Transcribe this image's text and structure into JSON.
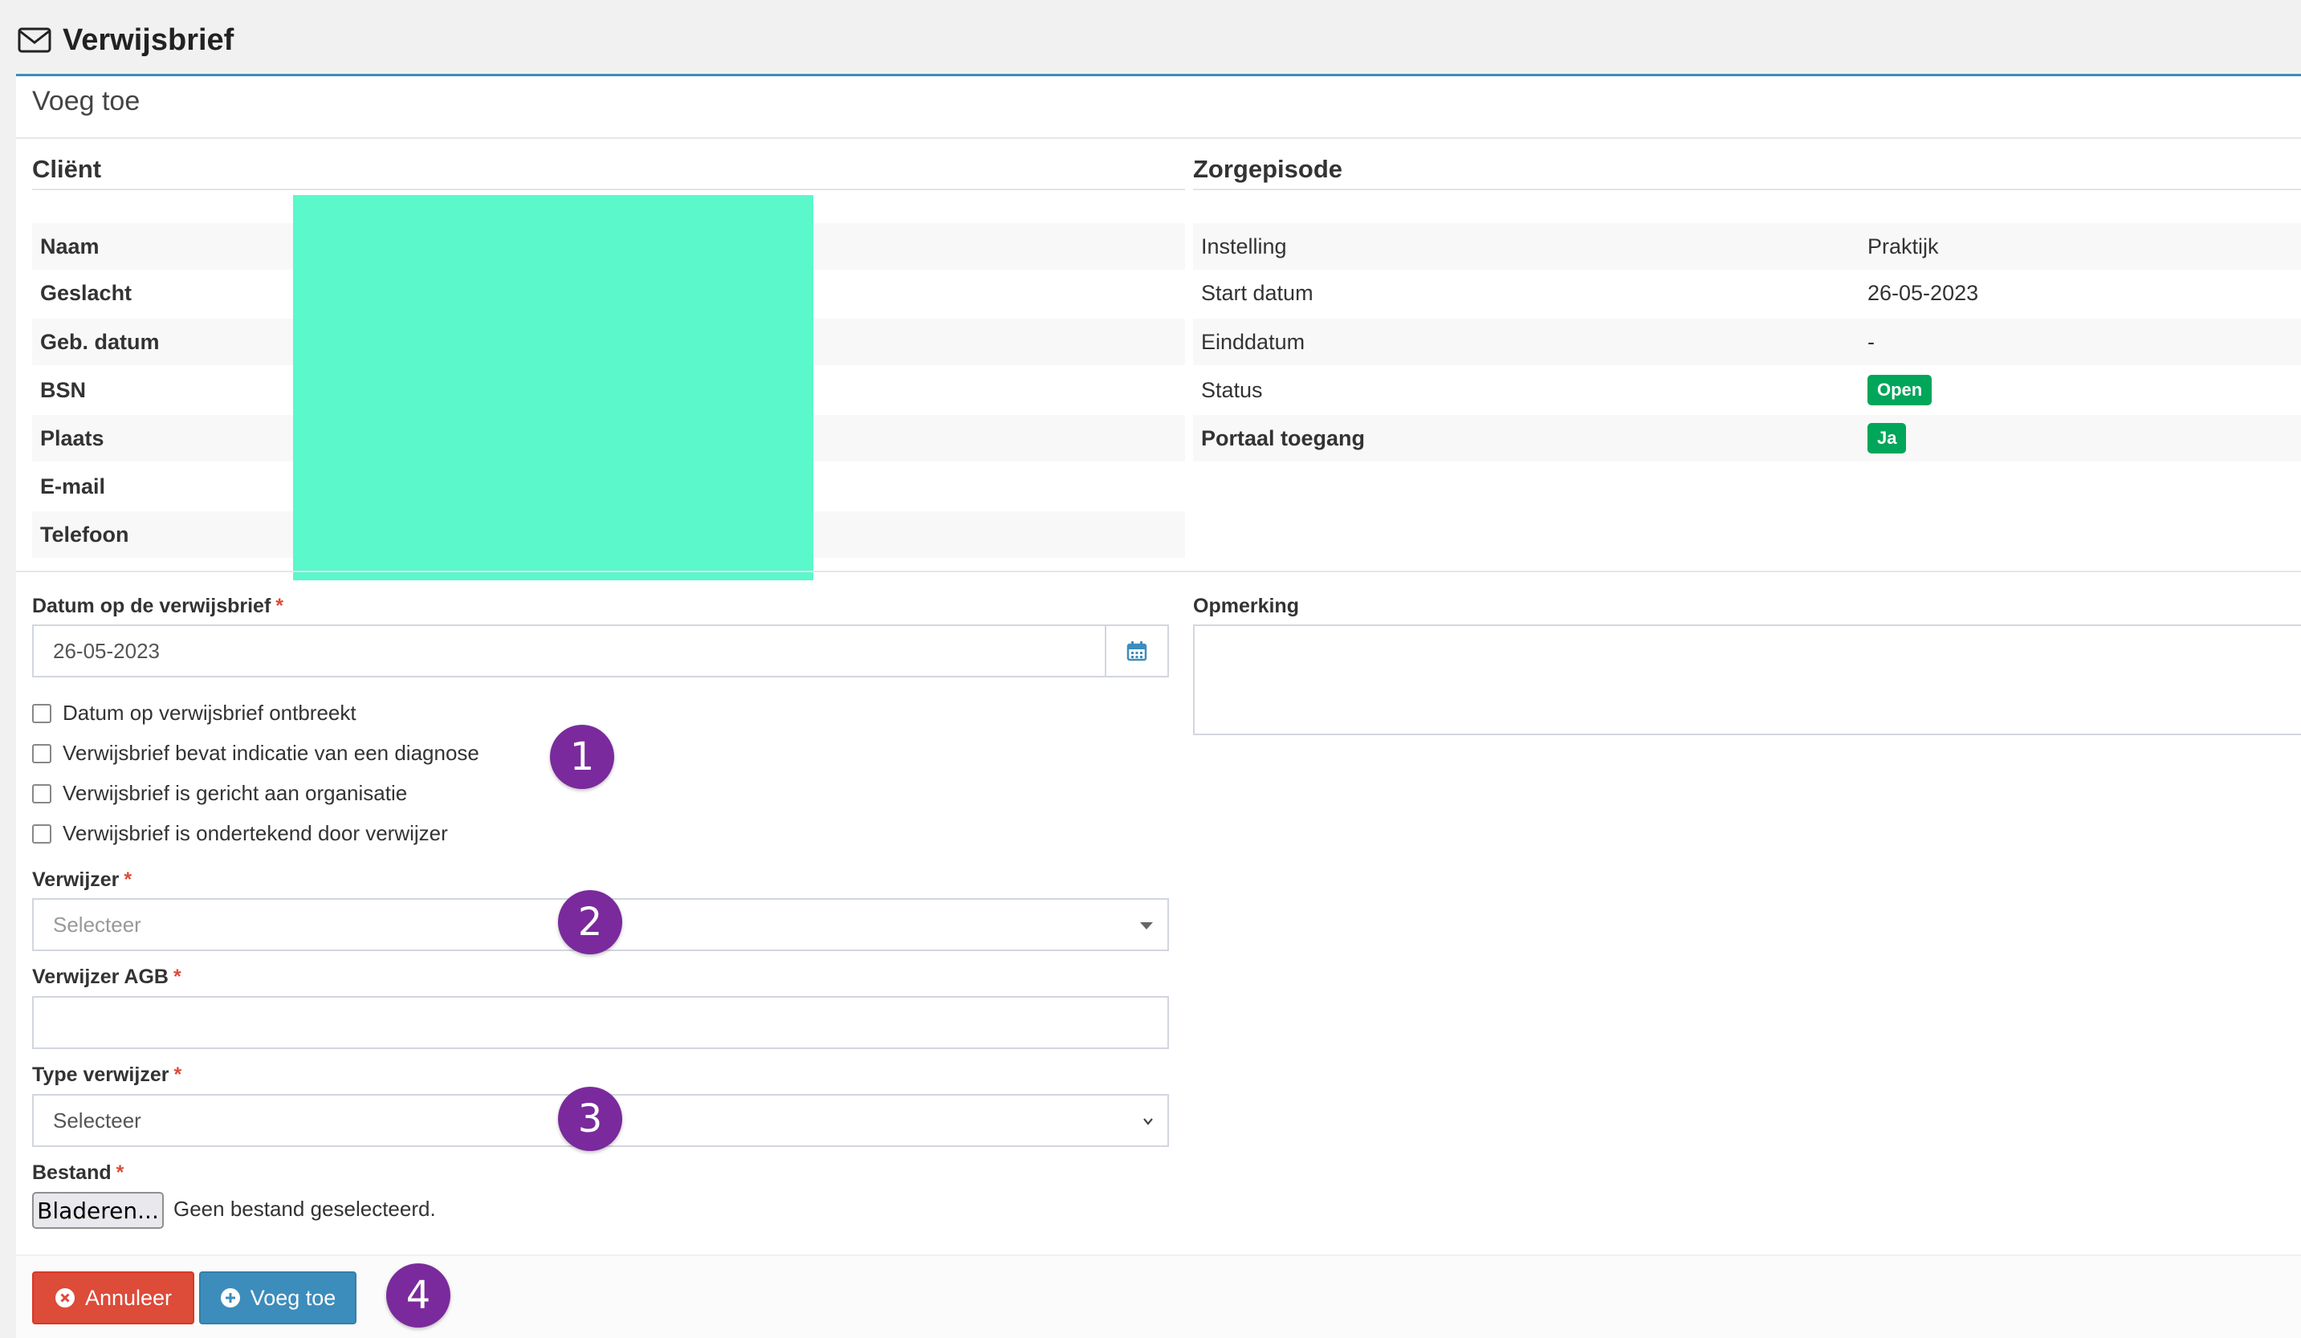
{
  "header": {
    "title": "Verwijsbrief",
    "icon": "envelope-icon"
  },
  "box": {
    "title": "Voeg toe"
  },
  "client": {
    "title": "Cliënt",
    "fields": [
      {
        "label": "Naam"
      },
      {
        "label": "Geslacht"
      },
      {
        "label": "Geb. datum"
      },
      {
        "label": "BSN"
      },
      {
        "label": "Plaats"
      },
      {
        "label": "E-mail"
      },
      {
        "label": "Telefoon"
      }
    ]
  },
  "zorgepisode": {
    "title": "Zorgepisode",
    "rows": [
      {
        "label": "Instelling",
        "value": "Praktijk"
      },
      {
        "label": "Start datum",
        "value": "26-05-2023"
      },
      {
        "label": "Einddatum",
        "value": "-"
      },
      {
        "label": "Status",
        "value": "Open",
        "color": "#00a65a"
      },
      {
        "label": "Portaal toegang",
        "value": "Ja",
        "color": "#00a65a"
      }
    ]
  },
  "form": {
    "date_label": "Datum op de verwijsbrief",
    "date_value": "26-05-2023",
    "required_mark": "*",
    "checkboxes": [
      {
        "label": "Datum op verwijsbrief ontbreekt",
        "checked": false
      },
      {
        "label": "Verwijsbrief bevat indicatie van een diagnose",
        "checked": false
      },
      {
        "label": "Verwijsbrief is gericht aan organisatie",
        "checked": false
      },
      {
        "label": "Verwijsbrief is ondertekend door verwijzer",
        "checked": false
      }
    ],
    "verwijzer_label": "Verwijzer",
    "verwijzer_placeholder": "Selecteer",
    "agb_label": "Verwijzer AGB",
    "agb_value": "",
    "type_label": "Type verwijzer",
    "type_value": "Selecteer",
    "bestand_label": "Bestand",
    "browse_label": "Bladeren...",
    "no_file_text": "Geen bestand geselecteerd.",
    "opmerking_label": "Opmerking",
    "opmerking_value": ""
  },
  "buttons": {
    "cancel_label": "Annuleer",
    "add_label": "Voeg toe",
    "cancel_color": "#dd4b39",
    "add_color": "#3c8dbc"
  },
  "markers": [
    "1",
    "2",
    "3",
    "4"
  ]
}
